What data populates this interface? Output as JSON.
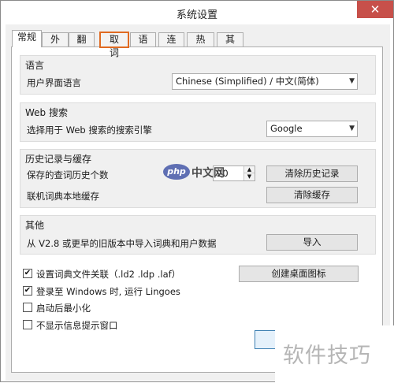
{
  "window": {
    "title": "系统设置",
    "close_glyph": "✕"
  },
  "tabs": [
    {
      "label": "常规"
    },
    {
      "label": "外观"
    },
    {
      "label": "翻译"
    },
    {
      "label": "取词"
    },
    {
      "label": "语音"
    },
    {
      "label": "连接"
    },
    {
      "label": "热键"
    },
    {
      "label": "其他"
    }
  ],
  "language": {
    "group_title": "语言",
    "ui_language_label": "用户界面语言",
    "ui_language_value": "Chinese (Simplified) / 中文(简体)"
  },
  "web_search": {
    "group_title": "Web 搜索",
    "engine_label": "选择用于 Web 搜索的搜索引擎",
    "engine_value": "Google"
  },
  "history": {
    "group_title": "历史记录与缓存",
    "count_label": "保存的查词历史个数",
    "count_value": "20",
    "clear_history_button": "清除历史记录",
    "cache_label": "联机词典本地缓存",
    "clear_cache_button": "清除缓存"
  },
  "other": {
    "group_title": "其他",
    "import_label": "从 V2.8 或更早的旧版本中导入词典和用户数据",
    "import_button": "导入"
  },
  "options": {
    "file_assoc": {
      "label": "设置词典文件关联（.ld2 .ldp .laf）",
      "checked": true
    },
    "run_on_login": {
      "label": "登录至 Windows 时, 运行 Lingoes",
      "checked": true
    },
    "minimize_on_start": {
      "label": "启动后最小化",
      "checked": false
    },
    "hide_tips": {
      "label": "不显示信息提示窗口",
      "checked": false
    },
    "desktop_icon_button": "创建桌面图标"
  },
  "overlays": {
    "php_logo_text": "php",
    "php_logo_cn": "中文网",
    "watermark_text": "软件技巧"
  },
  "colors": {
    "close": "#c7504a",
    "highlight": "#e06a21",
    "php_logo": "#5f6fb3"
  }
}
